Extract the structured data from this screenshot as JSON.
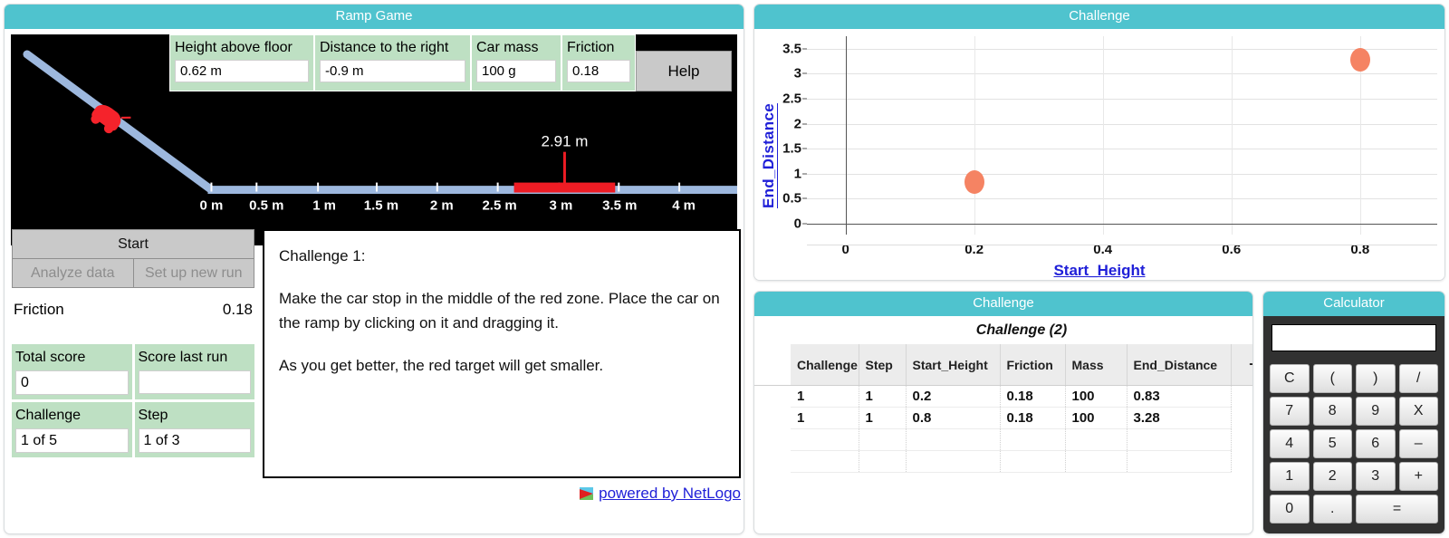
{
  "ramp_game": {
    "title": "Ramp Game",
    "params": [
      {
        "label": "Height above floor",
        "value": "0.62 m"
      },
      {
        "label": "Distance to the right",
        "value": "-0.9 m"
      },
      {
        "label": "Car mass",
        "value": "100 g"
      },
      {
        "label": "Friction",
        "value": "0.18"
      }
    ],
    "help_label": "Help",
    "buttons": {
      "start": "Start",
      "analyze": "Analyze data",
      "setup": "Set up new run"
    },
    "friction": {
      "label": "Friction",
      "value": "0.18"
    },
    "scores": [
      {
        "label": "Total score",
        "value": "0"
      },
      {
        "label": "Score last run",
        "value": ""
      },
      {
        "label": "Challenge",
        "value": "1 of 5"
      },
      {
        "label": "Step",
        "value": "1 of 3"
      }
    ],
    "challenge_text": {
      "heading": "Challenge 1:",
      "paragraph1": "Make the car stop in the middle of the red zone. Place the car on the ramp by clicking on it and dragging it.",
      "paragraph2": "As you get better, the red target will get smaller."
    },
    "netlogo_link": "powered by NetLogo",
    "simulation": {
      "target_distance_label": "2.91 m",
      "ruler_ticks": [
        "0 m",
        "0.5 m",
        "1 m",
        "1.5 m",
        "2 m",
        "2.5 m",
        "3 m",
        "3.5 m",
        "4 m"
      ],
      "ramp_color": "#9DB8DE",
      "car_color": "#F5232B",
      "target_color": "#EE1C24",
      "background_color": "#000000"
    }
  },
  "chart_panel": {
    "title": "Challenge"
  },
  "chart_data": {
    "type": "scatter",
    "title": "Challenge",
    "xlabel": "Start_Height",
    "ylabel": "End_Distance",
    "xlim": [
      -0.06,
      0.92
    ],
    "ylim": [
      -0.22,
      3.75
    ],
    "xticks": [
      0,
      0.2,
      0.4,
      0.6,
      0.8
    ],
    "xtick_labels": [
      "0",
      "0.2",
      "0.4",
      "0.6",
      "0.8"
    ],
    "yticks": [
      0,
      0.5,
      1,
      1.5,
      2,
      2.5,
      3,
      3.5
    ],
    "ytick_labels": [
      "0",
      "0.5",
      "1",
      "1.5",
      "2",
      "2.5",
      "3",
      "3.5"
    ],
    "grid": true,
    "legend": "none",
    "point_color": "#F58363",
    "series": [
      {
        "name": "Challenge",
        "points": [
          {
            "x": 0.2,
            "y": 0.83
          },
          {
            "x": 0.8,
            "y": 3.28
          }
        ]
      }
    ]
  },
  "table_panel": {
    "title": "Challenge",
    "subtitle": "Challenge (2)",
    "add_column_label": "+",
    "columns": [
      "Challenge",
      "Step",
      "Start_Height",
      "Friction",
      "Mass",
      "End_Distance"
    ],
    "rows": [
      [
        "1",
        "1",
        "0.2",
        "0.18",
        "100",
        "0.83"
      ],
      [
        "1",
        "1",
        "0.8",
        "0.18",
        "100",
        "3.28"
      ]
    ],
    "empty_rows": 2
  },
  "calculator": {
    "title": "Calculator",
    "display": "",
    "keys": [
      "C",
      "(",
      ")",
      "/",
      "7",
      "8",
      "9",
      "X",
      "4",
      "5",
      "6",
      "–",
      "1",
      "2",
      "3",
      "+",
      "0",
      ".",
      "="
    ]
  },
  "colors": {
    "panel_header": "#4FC3CE",
    "field_green": "#BEE0C3",
    "accent_link": "#2020d8",
    "point_orange": "#F58363"
  }
}
